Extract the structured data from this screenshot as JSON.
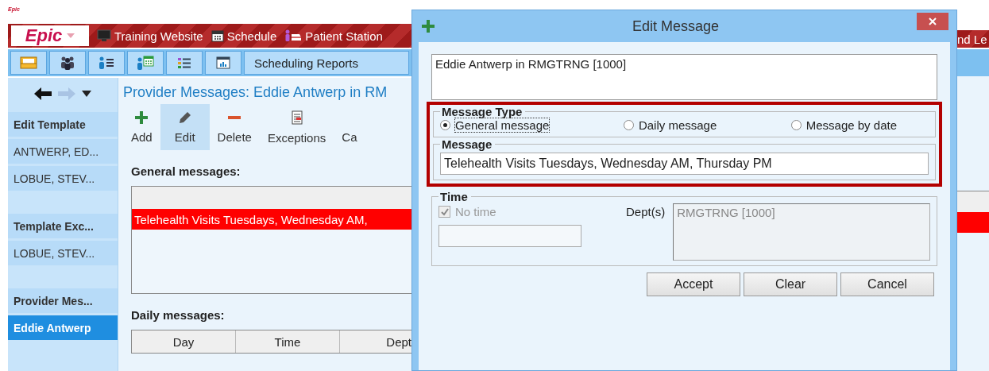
{
  "app_badge": "Epic",
  "header": {
    "logo": "Epic",
    "links": [
      {
        "label": "Training Website",
        "kind": "monitor"
      },
      {
        "label": "Schedule",
        "kind": "calendar"
      },
      {
        "label": "Patient Station",
        "kind": "station"
      }
    ],
    "cut_label": "nd Le"
  },
  "toolbar": {
    "icons": [
      {
        "kind": "mail"
      },
      {
        "kind": "group"
      },
      {
        "kind": "person-list"
      },
      {
        "kind": "person-calendar"
      },
      {
        "kind": "list"
      },
      {
        "kind": "chart"
      }
    ],
    "reports_label": "Scheduling Reports"
  },
  "sidebar": {
    "sections": [
      {
        "heading": "Edit Template",
        "items": [
          {
            "label": "ANTWERP, ED...",
            "selected": false
          },
          {
            "label": "LOBUE, STEV...",
            "selected": false
          }
        ]
      },
      {
        "heading": "Template Exc...",
        "items": [
          {
            "label": "LOBUE, STEV...",
            "selected": false
          }
        ]
      },
      {
        "heading": "Provider Mes...",
        "items": [
          {
            "label": "Eddie Antwerp",
            "selected": true
          }
        ]
      }
    ]
  },
  "main": {
    "title": "Provider Messages: Eddie Antwerp in RM",
    "actions": [
      {
        "label": "Add",
        "kind": "add",
        "selected": false
      },
      {
        "label": "Edit",
        "kind": "edit",
        "selected": true
      },
      {
        "label": "Delete",
        "kind": "delete",
        "selected": false
      },
      {
        "label": "Exceptions",
        "kind": "exceptions",
        "selected": false
      },
      {
        "label": "Ca",
        "kind": "other",
        "selected": false
      }
    ],
    "general_label": "General messages:",
    "general_rows": [
      {
        "text": "Telehealth Visits Tuesdays, Wednesday AM,",
        "selected": true
      }
    ],
    "daily_label": "Daily messages:",
    "daily_columns": [
      "Day",
      "Time",
      "Dept"
    ]
  },
  "dialog": {
    "title": "Edit Message",
    "recipient": "Eddie Antwerp in RMGTRNG [1000]",
    "type_legend": "Message Type",
    "types": [
      {
        "label": "General message",
        "selected": true
      },
      {
        "label": "Daily message",
        "selected": false
      },
      {
        "label": "Message by date",
        "selected": false
      }
    ],
    "message_legend": "Message",
    "message": "Telehealth Visits Tuesdays, Wednesday AM, Thursday PM",
    "time_legend": "Time",
    "no_time": {
      "label": "No time",
      "checked": true,
      "disabled": true
    },
    "dept_label": "Dept(s)",
    "dept_value": "RMGTRNG [1000]",
    "buttons": [
      "Accept",
      "Clear",
      "Cancel"
    ]
  }
}
